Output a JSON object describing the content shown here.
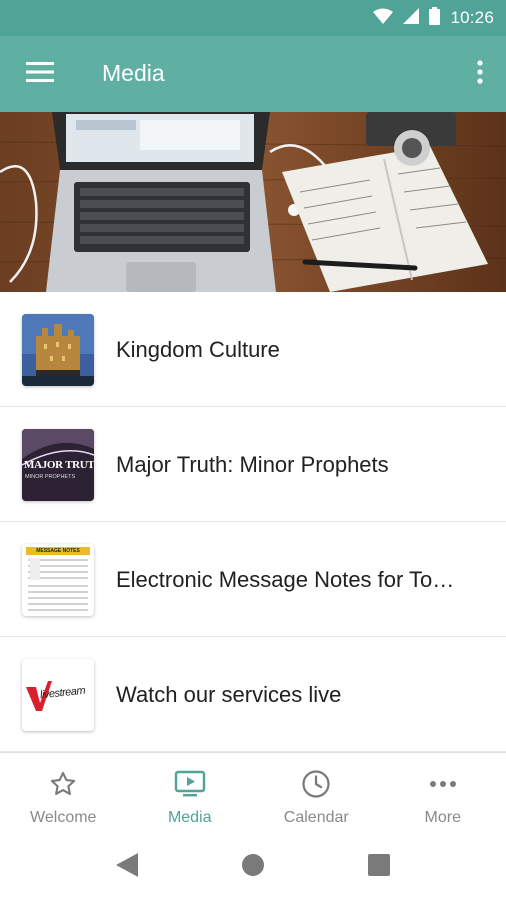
{
  "status_bar": {
    "time": "10:26",
    "icons": [
      "wifi-icon",
      "signal-icon",
      "battery-icon"
    ]
  },
  "app_bar": {
    "title": "Media",
    "menu_icon": "hamburger-menu-icon",
    "overflow_icon": "more-vertical-icon"
  },
  "hero": {
    "image": "laptop-notebook-desk-photo"
  },
  "media_list": [
    {
      "label": "Kingdom Culture",
      "thumb": "castle-thumbnail"
    },
    {
      "label": "Major Truth: Minor Prophets",
      "thumb": "major-truth-thumbnail",
      "thumb_text": "MAJOR TRUTH",
      "thumb_subtext": "MINOR PROPHETS"
    },
    {
      "label": "Electronic Message Notes for To…",
      "thumb": "message-notes-thumbnail",
      "thumb_text": "MESSAGE NOTES"
    },
    {
      "label": "Watch our services live",
      "thumb": "livestream-thumbnail",
      "thumb_text": "livestream"
    }
  ],
  "bottom_nav": {
    "tabs": [
      {
        "label": "Welcome",
        "icon": "star-icon",
        "active": false
      },
      {
        "label": "Media",
        "icon": "tv-play-icon",
        "active": true
      },
      {
        "label": "Calendar",
        "icon": "clock-icon",
        "active": false
      },
      {
        "label": "More",
        "icon": "more-horizontal-icon",
        "active": false
      }
    ]
  },
  "system_nav": {
    "buttons": [
      "back-icon",
      "home-icon",
      "recents-icon"
    ]
  },
  "colors": {
    "status_bar": "#4fa497",
    "app_bar": "#5fb0a3",
    "accent": "#4fa497",
    "inactive": "#8a8a8a"
  }
}
